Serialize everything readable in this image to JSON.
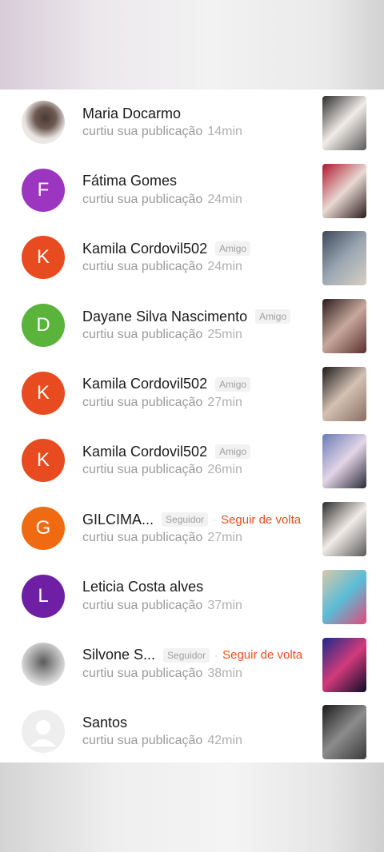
{
  "notifications": [
    {
      "name": "Maria Docarmo",
      "action": "curtiu sua publicação",
      "time": "14min",
      "tag": "",
      "follow": "",
      "avatar": {
        "type": "photo",
        "initial": "",
        "color": "",
        "style": "photo-dark"
      },
      "thumb": {
        "colors": [
          "#2c2c2c",
          "#f1ece8",
          "#5a5a5a"
        ]
      }
    },
    {
      "name": "Fátima Gomes",
      "action": "curtiu sua publicação",
      "time": "24min",
      "tag": "",
      "follow": "",
      "avatar": {
        "type": "letter",
        "initial": "F",
        "color": "#9c35c0"
      },
      "thumb": {
        "colors": [
          "#b0172d",
          "#e8d9d2",
          "#2a1a1a"
        ]
      }
    },
    {
      "name": "Kamila Cordovil502",
      "action": "curtiu sua publicação",
      "time": "24min",
      "tag": "Amigo",
      "follow": "",
      "avatar": {
        "type": "letter",
        "initial": "K",
        "color": "#e84b1f"
      },
      "thumb": {
        "colors": [
          "#3e4a5a",
          "#9aa6b2",
          "#d8d0c4"
        ]
      }
    },
    {
      "name": "Dayane Silva Nascimento",
      "action": "curtiu sua publicação",
      "time": "25min",
      "tag": "Amigo",
      "follow": "",
      "avatar": {
        "type": "letter",
        "initial": "D",
        "color": "#5ab33a"
      },
      "thumb": {
        "colors": [
          "#2b1c1c",
          "#c7a89d",
          "#5a2f2f"
        ]
      }
    },
    {
      "name": "Kamila Cordovil502",
      "action": "curtiu sua publicação",
      "time": "27min",
      "tag": "Amigo",
      "follow": "",
      "avatar": {
        "type": "letter",
        "initial": "K",
        "color": "#e84b1f"
      },
      "thumb": {
        "colors": [
          "#1e1a1a",
          "#d3c1b4",
          "#8a6e62"
        ]
      }
    },
    {
      "name": "Kamila Cordovil502",
      "action": "curtiu sua publicação",
      "time": "26min",
      "tag": "Amigo",
      "follow": "",
      "avatar": {
        "type": "letter",
        "initial": "K",
        "color": "#e84b1f"
      },
      "thumb": {
        "colors": [
          "#6a7ab8",
          "#e3d5e6",
          "#2a2a3a"
        ]
      }
    },
    {
      "name": "GILCIMA...",
      "action": "curtiu sua publicação",
      "time": "27min",
      "tag": "Seguidor",
      "follow": "Seguir de volta",
      "avatar": {
        "type": "letter",
        "initial": "G",
        "color": "#ef6a10"
      },
      "thumb": {
        "colors": [
          "#2c2c2c",
          "#f1ece8",
          "#5a5a5a"
        ]
      }
    },
    {
      "name": "Leticia Costa alves",
      "action": "curtiu sua publicação",
      "time": "37min",
      "tag": "",
      "follow": "",
      "avatar": {
        "type": "letter",
        "initial": "L",
        "color": "#6e1fa3"
      },
      "thumb": {
        "colors": [
          "#d9c9a8",
          "#5bbcd6",
          "#e04a7a"
        ]
      }
    },
    {
      "name": "Silvone S...",
      "action": "curtiu sua publicação",
      "time": "38min",
      "tag": "Seguidor",
      "follow": "Seguir de volta",
      "avatar": {
        "type": "photo",
        "initial": "",
        "color": "",
        "style": "photo-gray"
      },
      "thumb": {
        "colors": [
          "#1c2a8a",
          "#d23a7a",
          "#0c0c2a"
        ]
      }
    },
    {
      "name": "Santos",
      "action": "curtiu sua publicação",
      "time": "42min",
      "tag": "",
      "follow": "",
      "avatar": {
        "type": "placeholder",
        "initial": "",
        "color": "#eeeeee"
      },
      "thumb": {
        "colors": [
          "#1b1b1b",
          "#8c8c8c",
          "#3a3a3a"
        ]
      }
    }
  ]
}
